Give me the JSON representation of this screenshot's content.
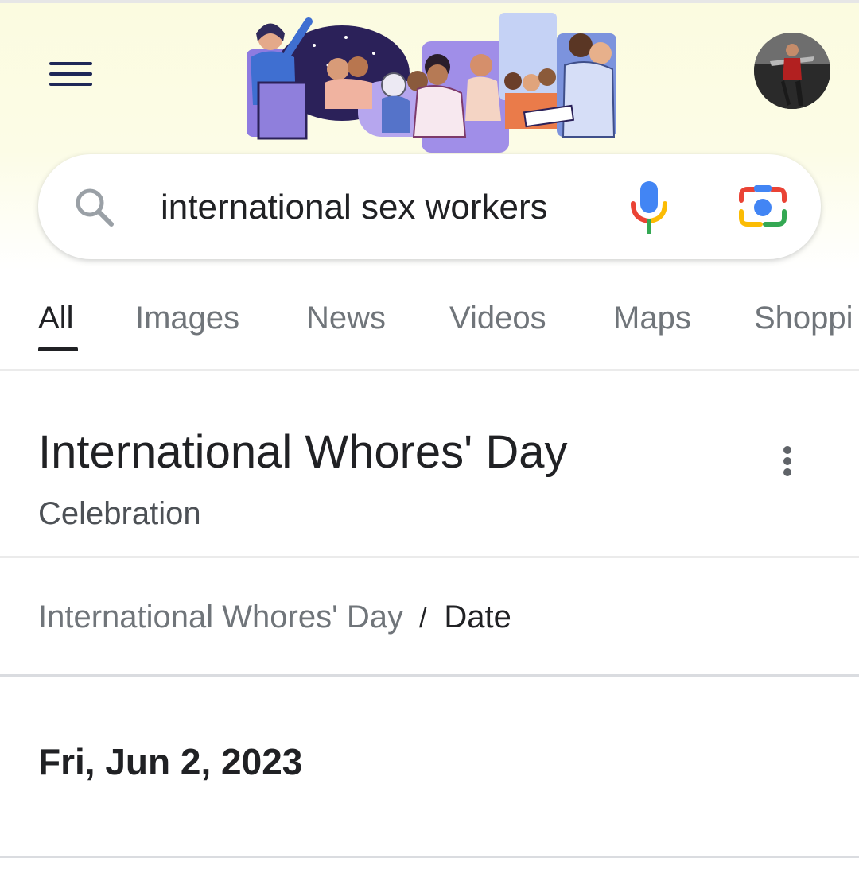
{
  "search": {
    "query": "international sex workers"
  },
  "tabs": [
    {
      "label": "All",
      "active": true
    },
    {
      "label": "Images",
      "active": false
    },
    {
      "label": "News",
      "active": false
    },
    {
      "label": "Videos",
      "active": false
    },
    {
      "label": "Maps",
      "active": false
    },
    {
      "label": "Shoppi",
      "active": false
    }
  ],
  "entity": {
    "title": "International Whores' Day",
    "subtitle": "Celebration"
  },
  "breadcrumb": {
    "parent": "International Whores' Day",
    "separator": "/",
    "current": "Date"
  },
  "answer": {
    "value": "Fri, Jun 2, 2023"
  },
  "icons": {
    "menu": "hamburger-menu-icon",
    "search": "search-icon",
    "mic": "microphone-icon",
    "lens": "google-lens-camera-icon",
    "more": "more-vertical-icon"
  },
  "colors": {
    "header_bg": "#fbfbe0",
    "menu_icon": "#1f2857",
    "doodle_purple": "#7b5fd6",
    "google_blue": "#4285f4",
    "google_red": "#ea4335",
    "google_yellow": "#fbbc04",
    "google_green": "#34a853"
  }
}
